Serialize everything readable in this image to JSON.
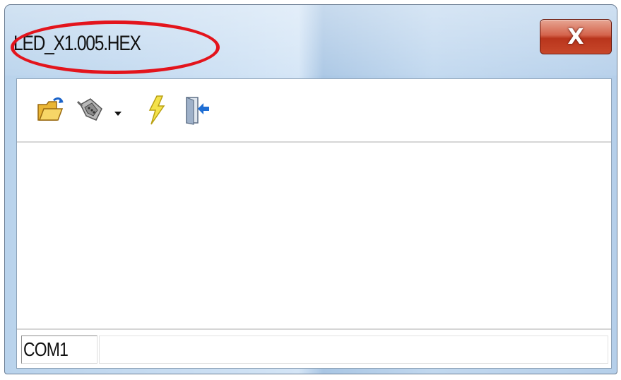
{
  "window": {
    "title": "LED_X1.005.HEX",
    "close_label": "X"
  },
  "toolbar": {
    "items": [
      {
        "icon": "open-folder-icon",
        "interactable": true
      },
      {
        "icon": "serial-port-connector-icon",
        "interactable": true
      },
      {
        "icon": "dropdown-arrow-icon",
        "interactable": true
      },
      {
        "icon": "lightning-flash-icon",
        "interactable": true
      },
      {
        "icon": "exit-door-icon",
        "interactable": true
      }
    ]
  },
  "statusbar": {
    "port": "COM1"
  },
  "annotation": {
    "shape": "ellipse",
    "color": "#e3141c"
  },
  "colors": {
    "title_bar": "#c1d8ef",
    "close_button": "#c7472a"
  }
}
